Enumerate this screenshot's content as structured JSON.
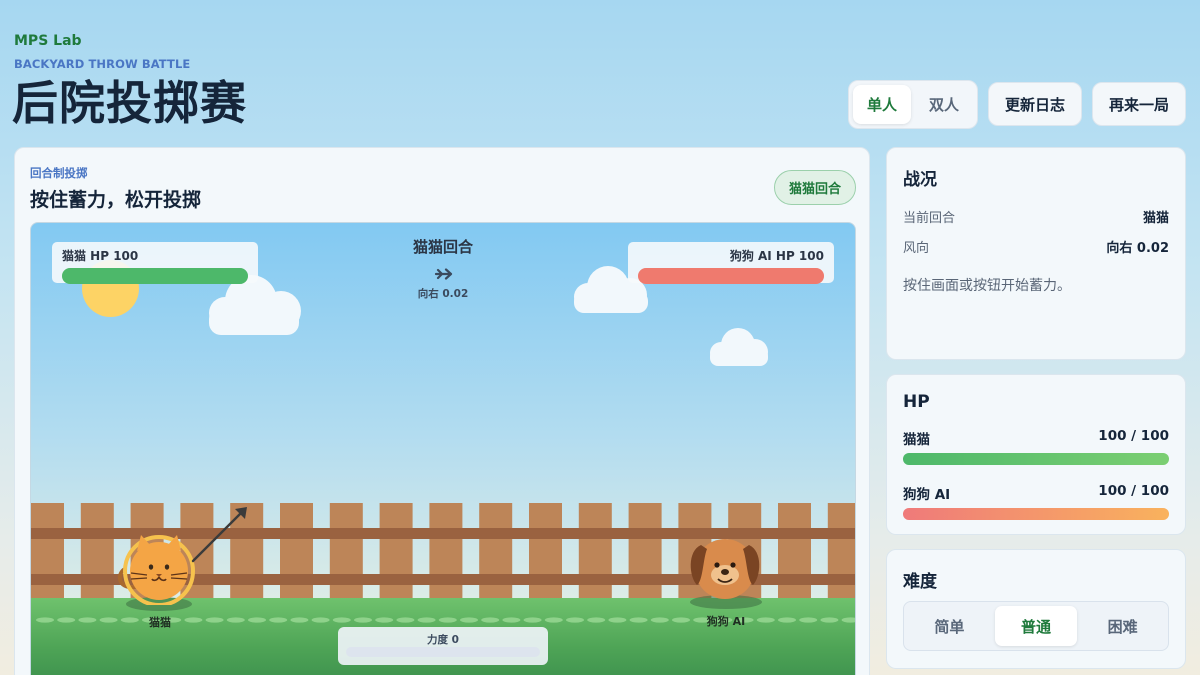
{
  "header": {
    "brand": "MPS Lab",
    "eyebrow": "BACKYARD THROW BATTLE",
    "title": "后院投掷赛",
    "mode_toggle": {
      "single": "单人",
      "double": "双人",
      "selected": "单人"
    },
    "changelog_button": "更新日志",
    "restart_button": "再来一局"
  },
  "game": {
    "eyebrow": "回合制投掷",
    "title": "按住蓄力，松开投掷",
    "turn_badge": "猫猫回合",
    "stage": {
      "cat_hp_label": "猫猫 HP 100",
      "dog_hp_label": "狗狗 AI HP 100",
      "turn_text": "猫猫回合",
      "wind_text": "向右 0.02",
      "cat_name": "猫猫",
      "dog_name": "狗狗 AI",
      "power_label": "力度 0",
      "power": 0,
      "cat_hp_fraction": 1.0,
      "dog_hp_fraction": 1.0
    }
  },
  "status": {
    "title": "战况",
    "current_turn_label": "当前回合",
    "current_turn_value": "猫猫",
    "wind_label": "风向",
    "wind_value": "向右 0.02",
    "hint": "按住画面或按钮开始蓄力。"
  },
  "hp": {
    "title": "HP",
    "cat_name": "猫猫",
    "cat_value": "100 / 100",
    "dog_name": "狗狗 AI",
    "dog_value": "100 / 100"
  },
  "difficulty": {
    "title": "难度",
    "options": [
      "简单",
      "普通",
      "困难"
    ],
    "selected": "普通"
  },
  "colors": {
    "brand_green": "#1f7a3c",
    "accent_blue": "#4a76c4",
    "cat_hp": "#4db86a",
    "dog_hp": "#ef7a6e"
  }
}
